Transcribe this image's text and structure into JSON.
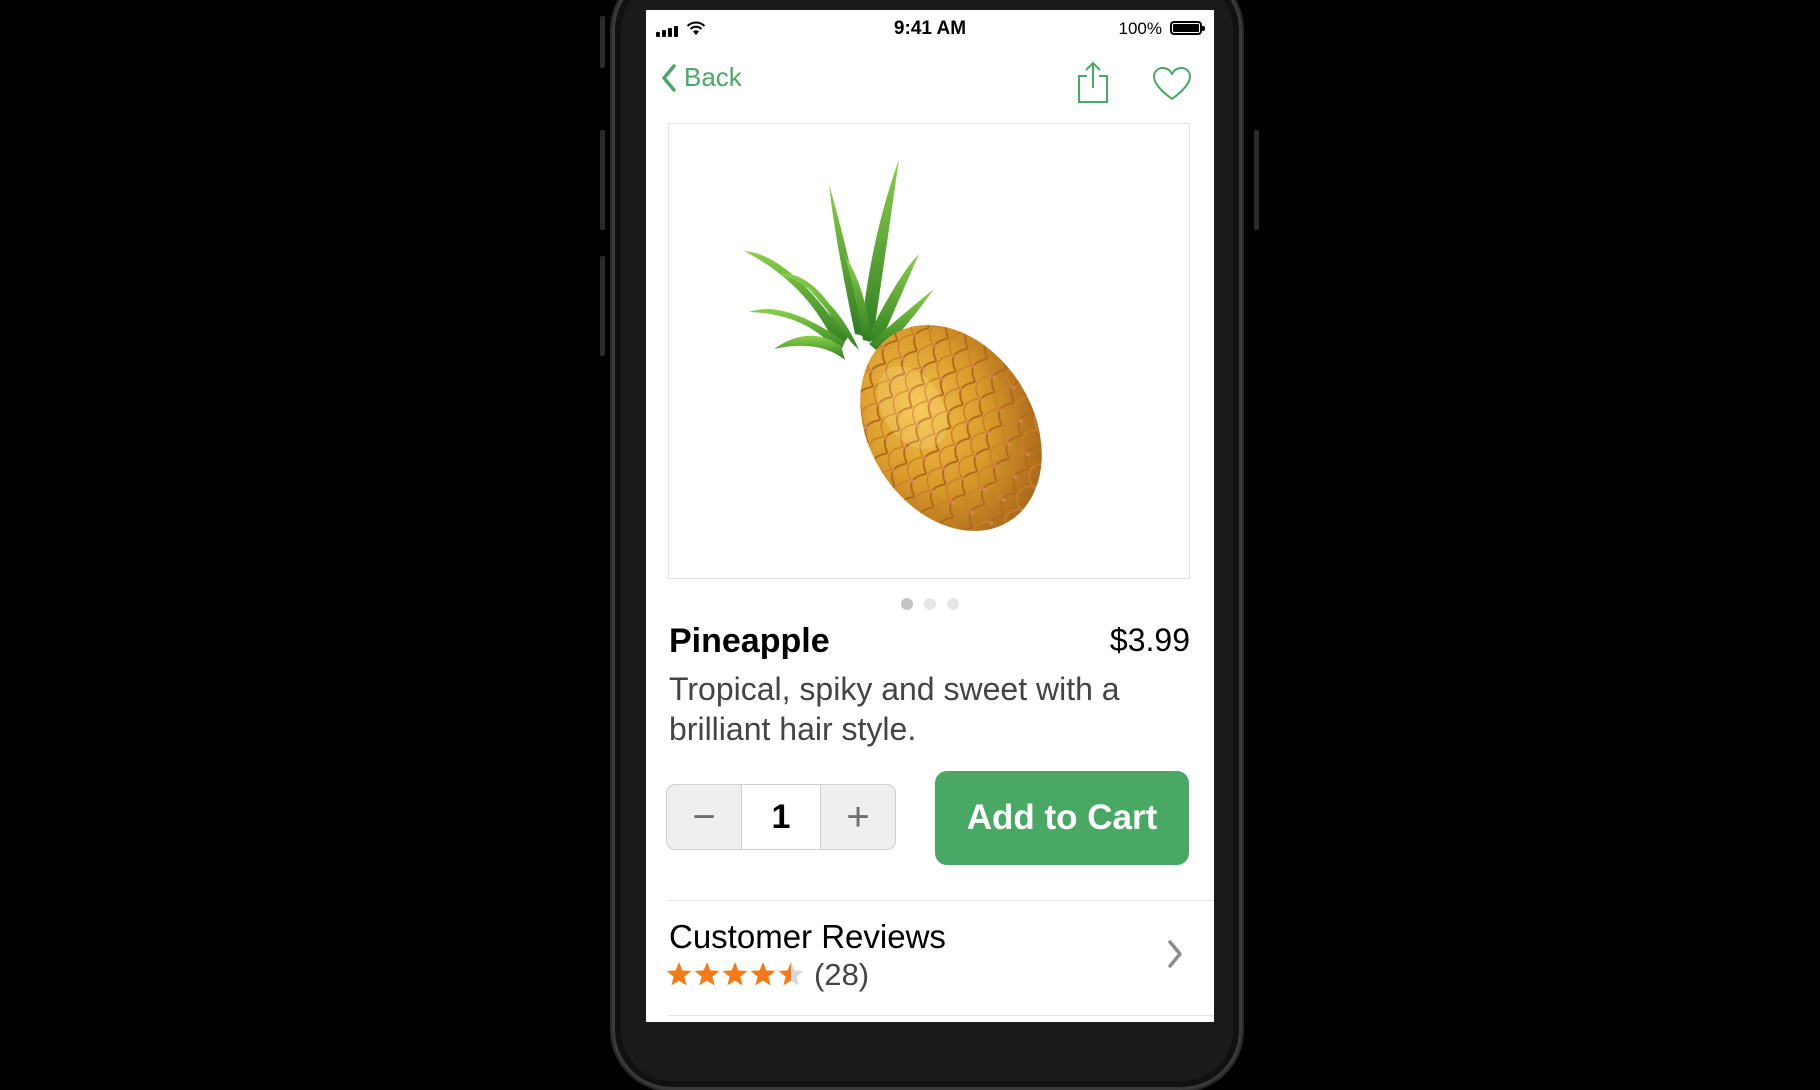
{
  "status_bar": {
    "time": "9:41 AM",
    "battery": "100%",
    "icons": [
      "signal-icon",
      "wifi-icon",
      "battery-icon"
    ]
  },
  "nav": {
    "back_label": "Back",
    "icons": [
      "chevron-left-icon",
      "share-icon",
      "heart-icon"
    ]
  },
  "product": {
    "image": "pineapple-image",
    "page_count": 3,
    "active_page": 1,
    "name": "Pineapple",
    "price": "$3.99",
    "description": "Tropical, spiky and sweet with a brilliant hair style."
  },
  "stepper": {
    "minus_symbol": "−",
    "quantity": "1",
    "plus_symbol": "+"
  },
  "cart": {
    "add_label": "Add to Cart"
  },
  "reviews": {
    "title": "Customer Reviews",
    "rating": 4.5,
    "max_rating": 5,
    "count_label": "(28)",
    "icons": [
      "star-icon",
      "chevron-right-icon"
    ]
  },
  "colors": {
    "accent": "#4aa865",
    "star": "#f37a18",
    "star_empty": "#d6d6d6"
  }
}
